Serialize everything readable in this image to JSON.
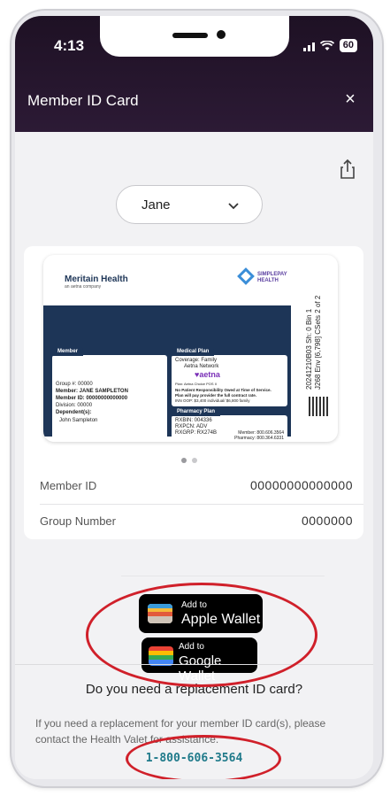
{
  "status_bar": {
    "time": "4:13",
    "battery": "60"
  },
  "header": {
    "title": "Member ID Card",
    "close_icon": "×"
  },
  "member_select": {
    "value": "Jane"
  },
  "id_card": {
    "brand": "Meritain Health",
    "brand_sub": "an aetna company",
    "partner_logo_text": "SIMPLEPAY HEALTH",
    "member_tab": "Member",
    "group_line": "Group #:  00000",
    "member_line": "Member: JANE SAMPLETON",
    "member_id_line": "Member ID: 00000000000000",
    "division_line": "Division:  00000",
    "dependents_label": "Dependent(s):",
    "dependent_name": "John Sampleton",
    "medical_tab": "Medical Plan",
    "coverage_line": "Coverage: Family",
    "network_line": "Aetna Network",
    "aetna_logo": "♥aetna",
    "plan_name": "Plan: Aetna Choice POS II",
    "medical_note_1": "No Patient Responsibility Owed at Time of Service.",
    "medical_note_2": "Plan will pay provider the full contract rate.",
    "medical_note_3": "INN OOP: $3,400 individual/ $6,800 family",
    "pharmacy_tab": "Pharmacy Plan",
    "rxbin": "RXBIN:  004336",
    "rxpcn": "RXPCN:  ADV",
    "rxgrp": "RXGRP:  RX274B",
    "member_phone": "Member: 800.606.3564",
    "pharmacy_phone": "Pharmacy: 800.364.6331",
    "vertical_text_1": "20241210B03 Sh: 0  Bin 1",
    "vertical_text_2": "J268 Env [6,798] CSets 2 of 2"
  },
  "details": [
    {
      "label": "Member ID",
      "value": "00000000000000"
    },
    {
      "label": "Group Number",
      "value": "0000000"
    }
  ],
  "wallets": {
    "apple": {
      "small": "Add to",
      "big": "Apple Wallet"
    },
    "google": {
      "small": "Add to",
      "big": "Google Wallet"
    }
  },
  "replacement": {
    "question": "Do you need a replacement ID card?",
    "info": "If you need a replacement for your member ID card(s), please contact the Health Valet for assistance.",
    "phone": "1-800-606-3564"
  },
  "colors": {
    "header_bg": "#1e1124",
    "card_navy": "#1d3557",
    "link": "#1f7a8a",
    "annotation_red": "#d0202a"
  }
}
